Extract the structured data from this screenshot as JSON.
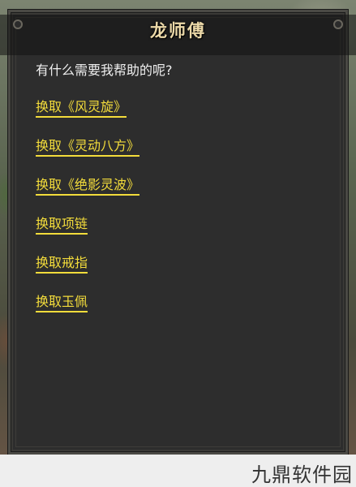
{
  "dialog": {
    "title": "龙师傅",
    "greeting": "有什么需要我帮助的呢?",
    "options": [
      {
        "label": "换取《风灵旋》"
      },
      {
        "label": "换取《灵动八方》"
      },
      {
        "label": "换取《绝影灵波》"
      },
      {
        "label": "换取项链"
      },
      {
        "label": "换取戒指"
      },
      {
        "label": "换取玉佩"
      }
    ]
  },
  "watermark": {
    "text": "九鼎软件园"
  },
  "colors": {
    "panel_bg": "#2d2d2d",
    "option_text": "#f3dc3b",
    "greeting_text": "#efefef",
    "title_text": "#ecd9a8"
  }
}
